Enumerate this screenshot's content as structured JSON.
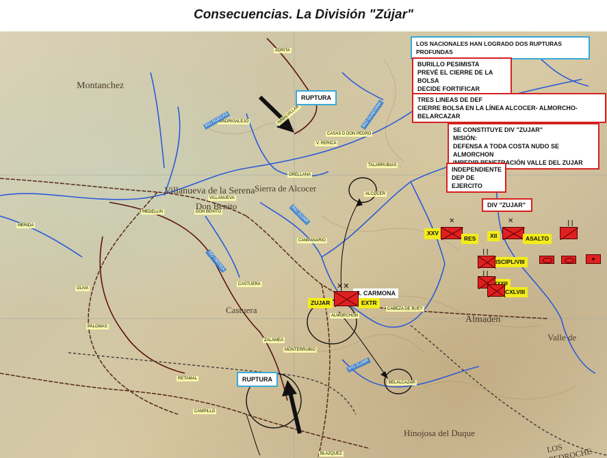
{
  "title": "Consecuencias. La División \"Zújar\"",
  "notes": {
    "rupturas": "LOS NACIONALES HAN LOGRADO DOS RUPTURAS PROFUNDAS",
    "burillo": [
      "BURILLO PESIMISTA",
      "PREVÉ EL CIERRE DE LA BOLSA",
      "DECIDE FORTIFICAR"
    ],
    "lineas": [
      "TRES LINEAS DE DEF",
      "CIERRE  BOLSA EN LA LÍNEA  ALCOCER- ALMORCHO-BELARCAZAR"
    ],
    "division": [
      "SE CONSTITUYE DIV \"ZUJAR\"",
      "MISIÓN:",
      "DEFENSA A TODA COSTA NUDO SE ALMORCHON",
      "IMPEDIR PENETRACIÓN  VALLE DEL ZUJAR"
    ],
    "independiente": [
      "INDEPENDIENTE",
      "DEP DE EJERCITO"
    ]
  },
  "labels": {
    "ruptura_north": "RUPTURA",
    "ruptura_south": "RUPTURA",
    "div_zujar": "DIV \"ZUJAR\"",
    "carmona": "S. CARMONA",
    "zujar": "ZUJAR",
    "extr": "EXTR",
    "xxv": "XXV",
    "res": "RES",
    "xii": "XII",
    "asalto": "ASALTO",
    "discipl": "DISCIPL/VIII",
    "xlviii": "CXLVIII",
    "xxxiii": "XXXIII"
  },
  "towns": {
    "merida": "MERIDA",
    "madrigalejo": "MADRIGALEJO",
    "navalvillar": "NAVALVILLAR",
    "casas_don_pedro": "CASAS D DON PEDRO",
    "talarrubias": "TALARRUBIAS",
    "orellana": "ORELLANA",
    "alcocer": "ALCOCER",
    "villanueva": "VILLANUEVA",
    "don_benito": "DON BENITO",
    "medellin": "MEDELLIN",
    "campanario": "CAMPANARIO",
    "castuera": "CASTUERA",
    "almorchon": "ALMORCHÓN",
    "cabeza_de_buey": "CABEZA DE BUEY",
    "zalamea": "ZALAMEA",
    "monterrubio": "MONTERRUBIO",
    "belalcazar": "BELALCAZAR",
    "retamal": "RETAMAL",
    "campillo": "CAMPILLO",
    "palomas": "PALOMAS",
    "oliva": "OLIVA",
    "blazquez": "BLAZQUEZ",
    "zorita": "ZORITA",
    "v_rerica": "V. RERICA"
  },
  "rivers": {
    "guadiana": "RIO GUADIANA",
    "ruecas": "RIO RUECAS",
    "zujar": "RIO ZUJAR",
    "ortiga": "RIO ORTIGA",
    "zujar_south": "RIO ZUJAR"
  },
  "places": {
    "montanchez": "Montanchez",
    "villanueva_serena": "Villanueva de la Serena",
    "don_benito": "Don Benito",
    "alcocer": "Sierra de Alcocer",
    "castuera": "Castuera",
    "almaden": "Almaden",
    "hinojosa": "Hinojosa del Duque",
    "valle": "Valle de",
    "pedroches": "LOS PEDROCHE"
  },
  "colors": {
    "note_border_red": "#d42020",
    "note_border_cyan": "#36a9d8",
    "unit_red": "#e02020",
    "label_yellow": "#f3ec1a",
    "river_blue": "#2a5ad8",
    "arrow_black": "#111111"
  }
}
